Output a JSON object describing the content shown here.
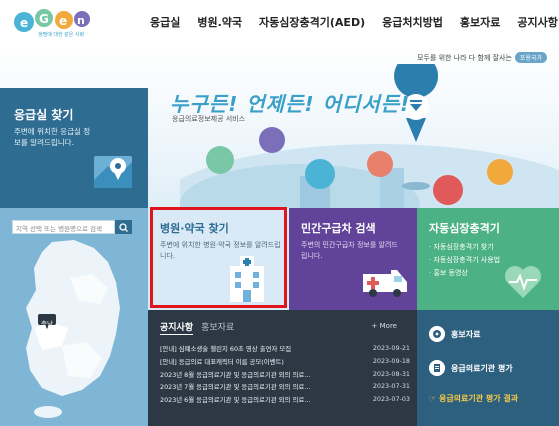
{
  "header": {
    "logo_tagline": "생명에 대한 같은 사랑",
    "nav": [
      "응급실",
      "병원.약국",
      "자동심장충격기(AED)",
      "응급처치방법",
      "홍보자료",
      "공지사항"
    ]
  },
  "hero": {
    "slogan": "모두를 위한 나라 다 함께 잘사는",
    "slogan_badge": "포용국가",
    "title": "누구든! 언제든! 어디서든!",
    "subtitle": "응급의료정보제공 서비스"
  },
  "er": {
    "title": "응급실 찾기",
    "desc": "주변에 위치한 응급실 정보를 알려드립니다."
  },
  "map": {
    "search_placeholder": "지역 선택 또는 병원명으로 검색",
    "marker_label": "충남"
  },
  "hospital": {
    "title": "병원·약국 찾기",
    "desc": "주변에 위치한 병원·약국 정보를 알려드립니다."
  },
  "ambulance": {
    "title": "민간구급차 검색",
    "desc": "주변의 민간구급차 정보를 알려드립니다."
  },
  "aed": {
    "title": "자동심장충격기",
    "items": [
      "· 자동심장충격기 찾기",
      "· 자동심장충격기 사용법",
      "· 홍보 동영상"
    ]
  },
  "notice": {
    "tab_active": "공지사항",
    "tab_other": "홍보자료",
    "more": "+ More",
    "rows": [
      {
        "title": "[안내] 심폐소생술 챌린지 60초 영상 출연자 모집",
        "date": "2023-09-21"
      },
      {
        "title": "[안내] 응급의료 대표캐릭터 이름 공모(이벤트)",
        "date": "2023-09-18"
      },
      {
        "title": "2023년 8월 응급의료기관 및 응급의료기관 외의 의료...",
        "date": "2023-08-31"
      },
      {
        "title": "2023년 7월 응급의료기관 및 응급의료기관 외의 의료...",
        "date": "2023-07-31"
      },
      {
        "title": "2023년 6월 응급의료기관 및 응급의료기관 외의 의료...",
        "date": "2023-07-03"
      }
    ]
  },
  "resources": {
    "promo": "홍보자료",
    "eval": "응급의료기관 평가",
    "eval_result": "☞ 응급의료기관 평가 결과"
  }
}
